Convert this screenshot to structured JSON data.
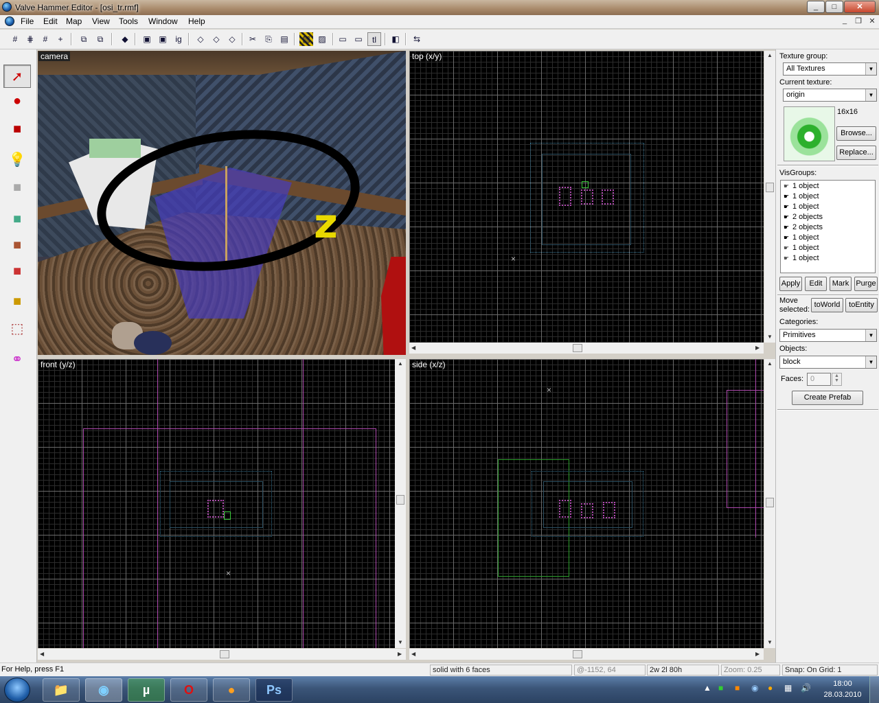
{
  "window": {
    "title": "Valve Hammer Editor - [osi_tr.rmf]",
    "min": "_",
    "max": "□",
    "close": "✕"
  },
  "menu": [
    "File",
    "Edit",
    "Map",
    "View",
    "Tools",
    "Window",
    "Help"
  ],
  "mdi": {
    "min": "_",
    "restore": "❐",
    "close": "✕"
  },
  "toolbar": [
    "#",
    "⋕",
    "#",
    "+",
    "⧉",
    "⧉",
    "◆",
    "▣",
    "▣",
    "ig",
    "◇",
    "◇",
    "◇",
    "✂",
    "⎘",
    "▤",
    "▨",
    "▨",
    "▭",
    "▭",
    "tl",
    "◧",
    "⇆"
  ],
  "tools": [
    "selection-tool",
    "magnify-tool",
    "camera-tool",
    "entity-tool",
    "block-tool",
    "texture-tool",
    "apply-texture-tool",
    "decal-tool",
    "clip-tool",
    "vertex-tool",
    "path-tool"
  ],
  "viewports": {
    "camera": "camera",
    "top": "top (x/y)",
    "front": "front (y/z)",
    "side": "side (x/z)",
    "gizmo_letter": "z"
  },
  "panel": {
    "texture_group_label": "Texture group:",
    "texture_group_value": "All Textures",
    "current_texture_label": "Current texture:",
    "current_texture_value": "origin",
    "texture_size": "16x16",
    "browse": "Browse...",
    "replace": "Replace...",
    "visgroups_label": "VisGroups:",
    "visgroups": [
      "1 object",
      "1 object",
      "1 object",
      "2 objects",
      "2 objects",
      "1 object",
      "1 object",
      "1 object"
    ],
    "apply": "Apply",
    "edit": "Edit",
    "mark": "Mark",
    "purge": "Purge",
    "move_selected_label_1": "Move",
    "move_selected_label_2": "selected:",
    "to_world": "toWorld",
    "to_entity": "toEntity",
    "categories_label": "Categories:",
    "categories_value": "Primitives",
    "objects_label": "Objects:",
    "objects_value": "block",
    "faces_label": "Faces:",
    "faces_value": "0",
    "create_prefab": "Create Prefab"
  },
  "status": {
    "help": "For Help, press F1",
    "selection": "solid with 6 faces",
    "coords": "@-1152, 64",
    "size": "2w 2l 80h",
    "zoom": "Zoom: 0.25",
    "snap": "Snap: On Grid: 1"
  },
  "taskbar": {
    "apps": [
      "📁",
      "◉",
      "µ",
      "O",
      "●",
      "Ps"
    ],
    "time": "18:00",
    "date": "28.03.2010"
  }
}
